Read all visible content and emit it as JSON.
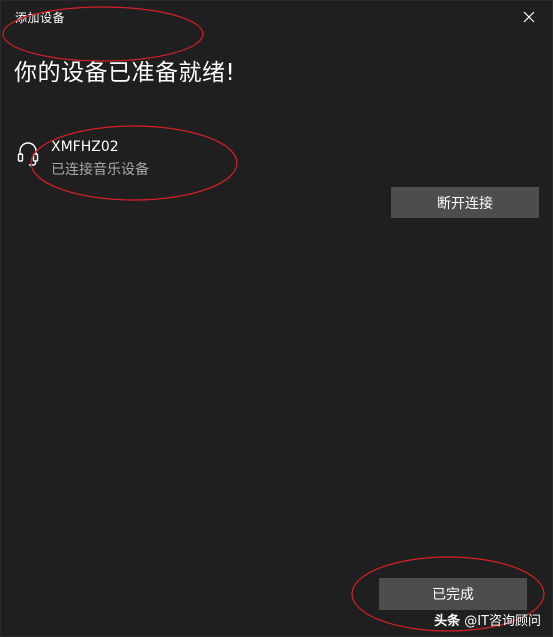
{
  "window": {
    "title": "添加设备",
    "close_icon": "close-icon"
  },
  "main": {
    "heading": "你的设备已准备就绪!"
  },
  "device": {
    "icon": "headphones-icon",
    "name": "XMFHZ02",
    "status": "已连接音乐设备"
  },
  "buttons": {
    "disconnect_label": "断开连接",
    "done_label": "已完成"
  },
  "watermark": {
    "brand": "头条",
    "handle": "@IT咨询顾问"
  },
  "colors": {
    "background": "#1f1f1f",
    "button": "#4d4d4d",
    "text": "#ffffff",
    "secondary_text": "#a8a8a8",
    "annotation": "#d81f26"
  }
}
